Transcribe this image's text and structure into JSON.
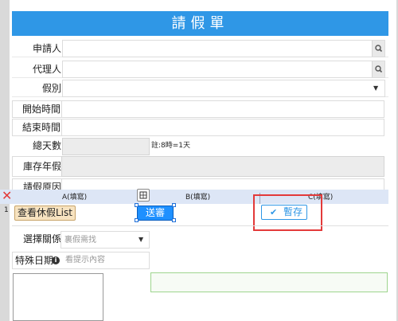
{
  "title": "請假單",
  "fields": {
    "applicant_label": "申請人",
    "agent_label": "代理人",
    "leave_type_label": "假別",
    "start_label": "開始時間",
    "end_label": "結束時間",
    "total_days_label": "總天數",
    "total_days_note": "註:8時=1天",
    "stock_label": "庫存年假",
    "reason_label": "請假原因"
  },
  "grid": {
    "columns": [
      "A(填寫)",
      "B(填寫)",
      "C(填寫)"
    ],
    "row_number": "1",
    "view_leave_button": "查看休假List",
    "submit_button": "送審",
    "temp_save_button": "暫存"
  },
  "select_relation": {
    "label": "選擇關係",
    "placeholder": "裏假需找"
  },
  "special_date": {
    "label": "特殊日期",
    "placeholder": "看提示內容"
  },
  "colors": {
    "header": "#2f97e6",
    "highlight_box": "#e33a3a",
    "submit_bg": "#1e90ff"
  }
}
